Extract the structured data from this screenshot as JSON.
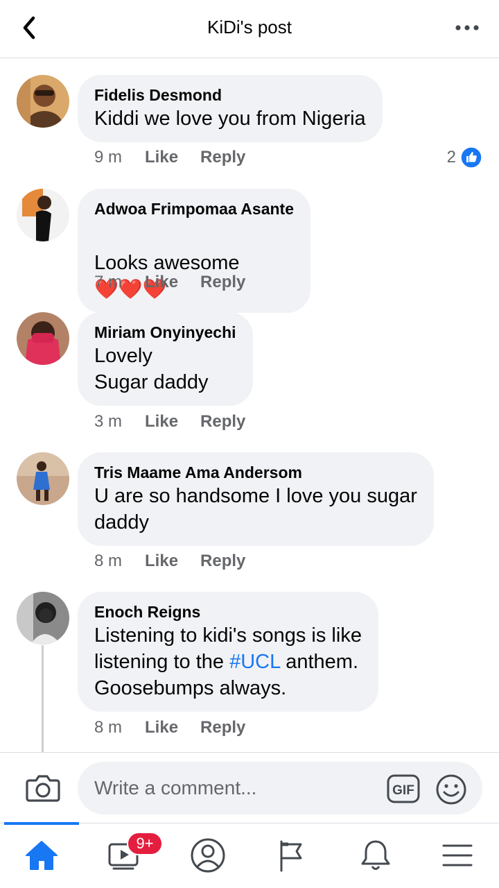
{
  "header": {
    "title": "KiDi's post"
  },
  "comments": [
    {
      "author": "Fidelis Desmond",
      "text": "Kiddi we love you from Nigeria",
      "time": "9 m",
      "like": "Like",
      "reply": "Reply",
      "reaction_count": "2"
    },
    {
      "author": "Adwoa Frimpomaa Asante",
      "text": "Looks awesome",
      "emoji": "❤️❤️❤️",
      "time": "7 m",
      "like": "Like",
      "reply": "Reply"
    },
    {
      "author": "Miriam Onyinyechi",
      "text": "Lovely\nSugar daddy",
      "time": "3 m",
      "like": "Like",
      "reply": "Reply"
    },
    {
      "author": "Tris Maame Ama Andersom",
      "text": "U are so handsome I love you sugar\ndaddy",
      "time": "8 m",
      "like": "Like",
      "reply": "Reply"
    },
    {
      "author": "Enoch Reigns",
      "text_before": "Listening to kidi's songs is like\nlistening to the ",
      "hashtag": "#UCL",
      "text_after": " anthem.\nGoosebumps always.",
      "time": "8 m",
      "like": "Like",
      "reply": "Reply"
    }
  ],
  "composer": {
    "placeholder": "Write a comment...",
    "gif_label": "GIF"
  },
  "nav": {
    "badge": "9+",
    "active": "home"
  },
  "colors": {
    "accent": "#1877f2",
    "bubble": "#f0f2f5",
    "secondary_text": "#65676b",
    "badge": "#e41e3f"
  }
}
